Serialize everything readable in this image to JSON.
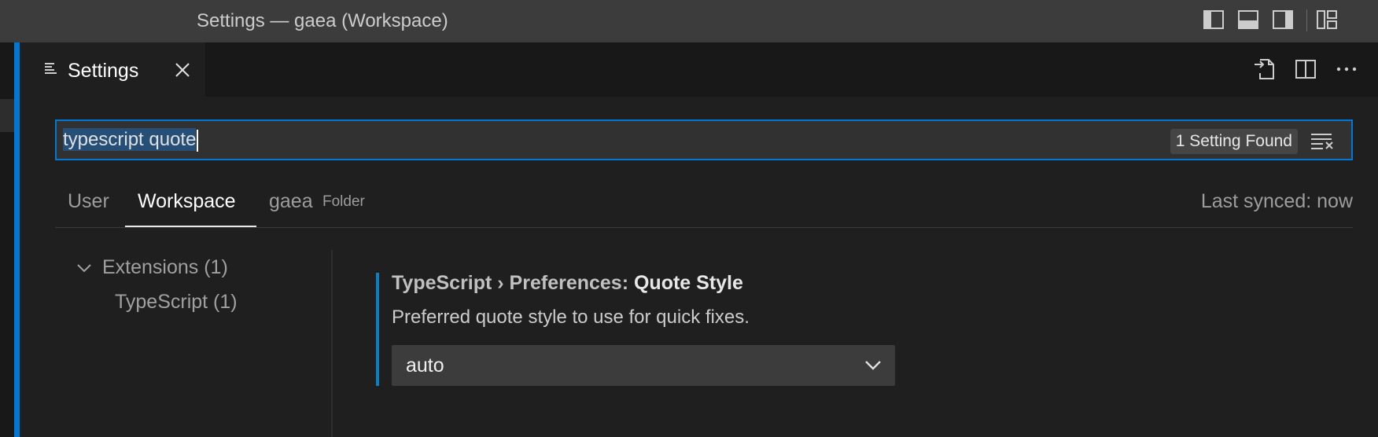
{
  "window": {
    "title": "Settings — gaea (Workspace)"
  },
  "titlebar_icons": [
    "toggle-primary-sidebar-icon",
    "toggle-panel-icon",
    "toggle-secondary-sidebar-icon",
    "customize-layout-icon"
  ],
  "tab": {
    "label": "Settings",
    "icon": "settings-list-icon",
    "close_icon": "close-icon"
  },
  "editor_actions": [
    "open-settings-json-icon",
    "split-editor-icon",
    "more-actions-icon"
  ],
  "search": {
    "query": "typescript quote",
    "result_count": "1 Setting Found",
    "clear_icon": "clear-filter-icon"
  },
  "scopes": {
    "user": "User",
    "workspace": "Workspace",
    "folder": "gaea",
    "folder_hint": "Folder",
    "active": "Workspace",
    "last_synced": "Last synced: now"
  },
  "toc": {
    "group": "Extensions (1)",
    "child": "TypeScript (1)"
  },
  "setting": {
    "category": "TypeScript › Preferences: ",
    "key": "Quote Style",
    "description": "Preferred quote style to use for quick fixes.",
    "value": "auto"
  },
  "colors": {
    "accent": "#0078d4",
    "background": "#1f1f1f",
    "titlebar": "#3c3c3c",
    "modified_indicator": "#0e7ec4"
  }
}
